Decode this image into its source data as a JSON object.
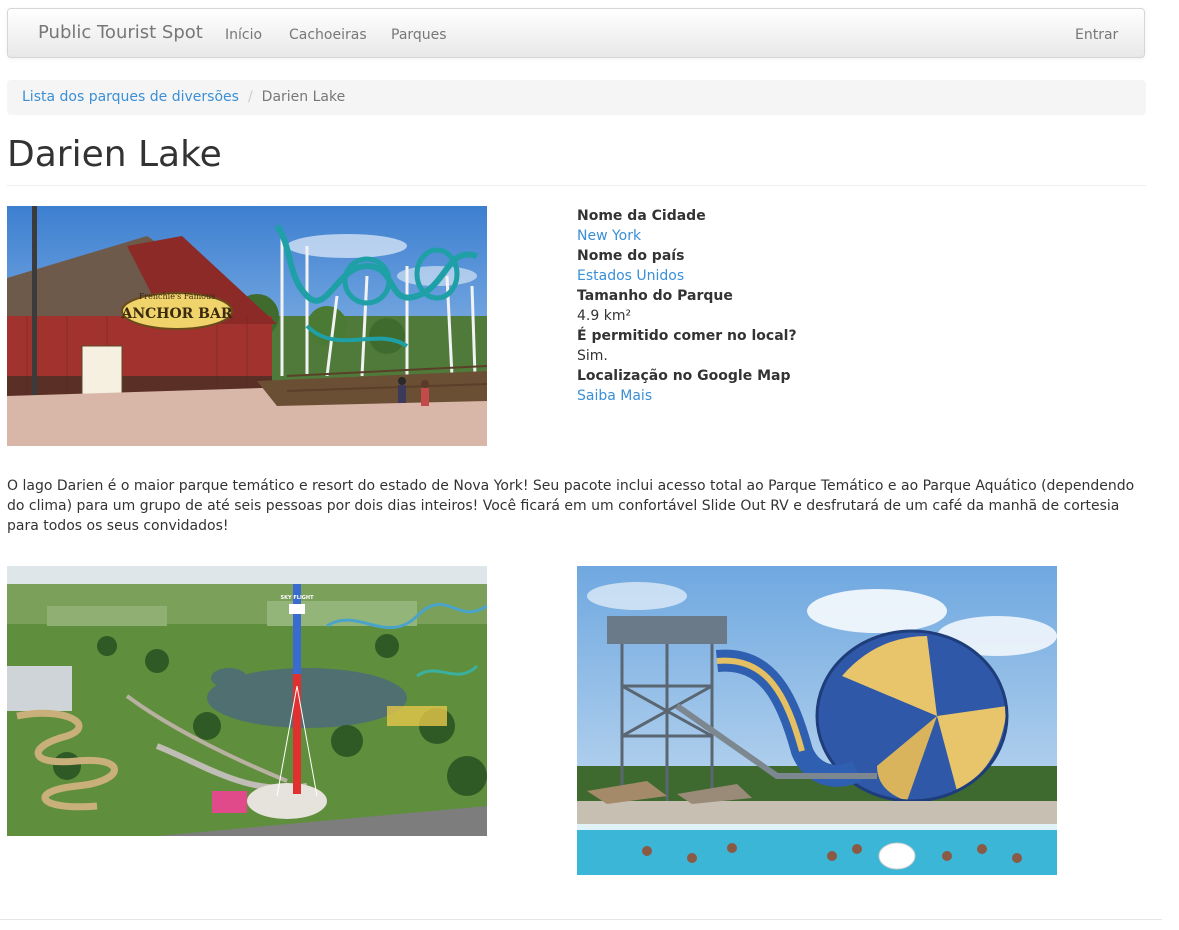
{
  "navbar": {
    "brand": "Public Tourist Spot",
    "items": [
      {
        "label": "Início"
      },
      {
        "label": "Cachoeiras"
      },
      {
        "label": "Parques"
      }
    ],
    "login_label": "Entrar"
  },
  "breadcrumb": {
    "link_label": "Lista dos parques de diversões",
    "separator": "/",
    "current": "Darien Lake"
  },
  "page": {
    "title": "Darien Lake"
  },
  "info": {
    "city_label": "Nome da Cidade",
    "city_value": "New York",
    "country_label": "Nome do país",
    "country_value": "Estados Unidos",
    "size_label": "Tamanho do Parque",
    "size_value": "4.9 km²",
    "eating_label": "É permitido comer no local?",
    "eating_value": "Sim.",
    "map_label": "Localização no Google Map",
    "map_link": "Saiba Mais"
  },
  "description": "O lago Darien é o maior parque temático e resort do estado de Nova York! Seu pacote inclui acesso total ao Parque Temático e ao Parque Aquático (dependendo do clima) para um grupo de até seis pessoas por dois dias inteiros! Você ficará em um confortável Slide Out RV e desfrutará de um café da manhã de cortesia para todos os seus convidados!",
  "images": {
    "anchor_sign_top": "Frenchie's Famous",
    "anchor_sign": "ANCHOR BAR",
    "tower_sign": "SKY FLIGHT"
  },
  "colors": {
    "link": "#3a8fd6",
    "text": "#333333",
    "muted": "#777777"
  }
}
